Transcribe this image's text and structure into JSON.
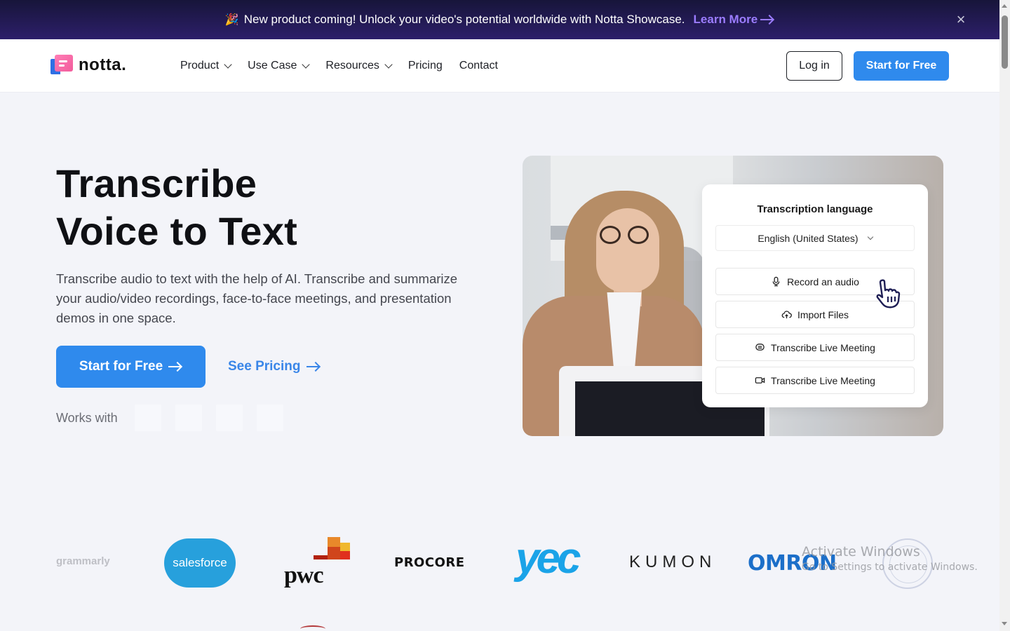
{
  "promo": {
    "icon": "party-popper-icon",
    "emoji": "🎉",
    "message": "New product coming! Unlock your video's potential worldwide with Notta Showcase.",
    "link_label": "Learn More",
    "close_icon": "×"
  },
  "header": {
    "brand": "notta.",
    "menu": [
      {
        "label": "Product",
        "has_dropdown": true
      },
      {
        "label": "Use Case",
        "has_dropdown": true
      },
      {
        "label": "Resources",
        "has_dropdown": true
      },
      {
        "label": "Pricing",
        "has_dropdown": false
      },
      {
        "label": "Contact",
        "has_dropdown": false
      }
    ],
    "login_label": "Log in",
    "start_label": "Start for Free"
  },
  "hero": {
    "title_line1": "Transcribe",
    "title_line2": "Voice to Text",
    "description": "Transcribe audio to text with the help of AI. Transcribe and summarize your audio/video recordings, face-to-face meetings, and presentation demos in one space.",
    "cta_primary": "Start for Free",
    "cta_secondary": "See Pricing",
    "works_with_label": "Works with"
  },
  "panel": {
    "title": "Transcription language",
    "language_selected": "English (United States)",
    "buttons": [
      {
        "label": "Record an audio",
        "icon": "microphone-icon"
      },
      {
        "label": "Import Files",
        "icon": "cloud-upload-icon"
      },
      {
        "label": "Transcribe Live Meeting",
        "icon": "meeting-bot-icon"
      },
      {
        "label": "Transcribe Live Meeting",
        "icon": "video-camera-icon"
      }
    ]
  },
  "logos": {
    "items": [
      "grammarly",
      "salesforce",
      "pwc",
      "PROCORE",
      "yec",
      "KUMON",
      "OMRON"
    ]
  },
  "windows_watermark": {
    "line1": "Activate Windows",
    "line2": "Go to Settings to activate Windows."
  },
  "colors": {
    "accent": "#2f8aed",
    "promo_link": "#9b7cff",
    "promo_bg": "#241a52",
    "page_bg": "#f3f4f9"
  }
}
